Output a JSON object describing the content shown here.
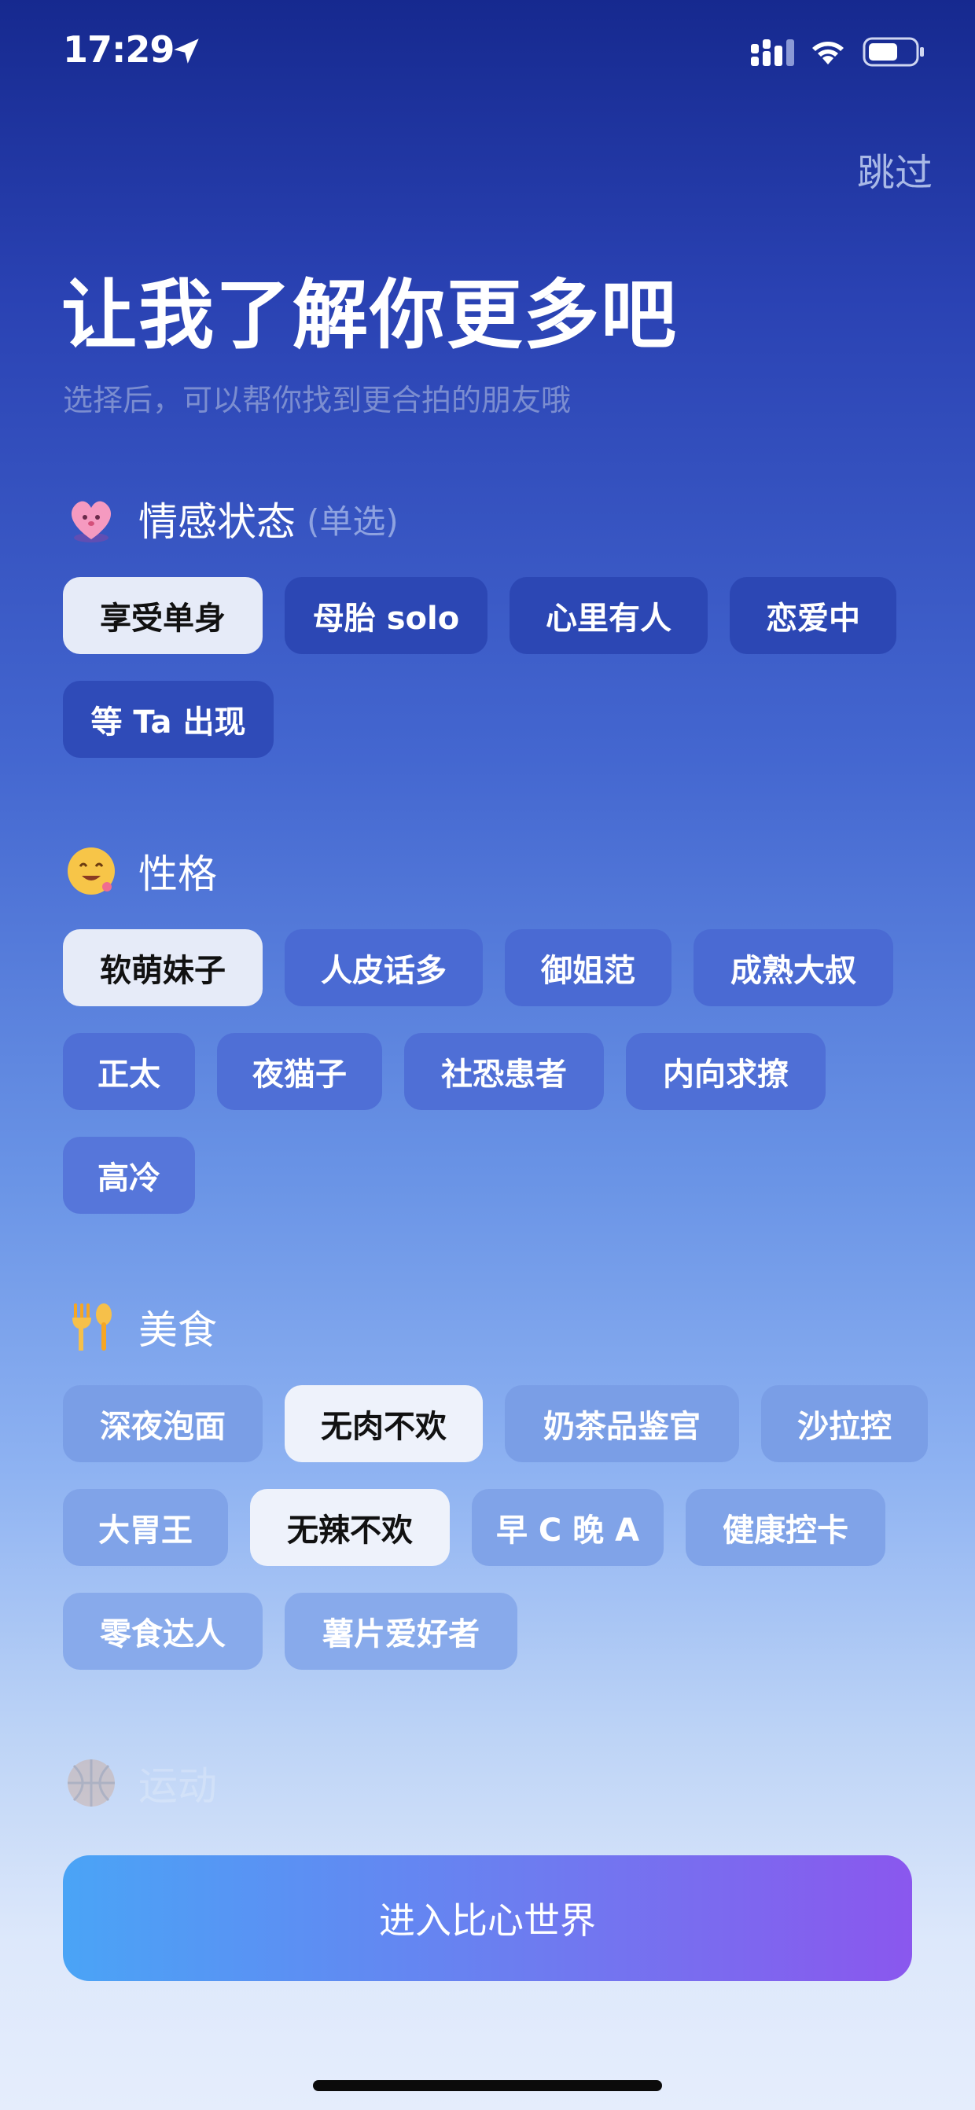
{
  "status_bar": {
    "time": "17:29",
    "icons": [
      "location-arrow-icon",
      "signal-icon",
      "wifi-icon",
      "battery-icon"
    ]
  },
  "header": {
    "skip_label": "跳过",
    "title": "让我了解你更多吧",
    "subtitle": "选择后，可以帮你找到更合拍的朋友哦"
  },
  "sections": {
    "emotion": {
      "title": "情感状态",
      "note": "(单选)",
      "icon": "heart-face-icon",
      "tags": [
        "享受单身",
        "母胎 solo",
        "心里有人",
        "恋爱中",
        "等 Ta 出现"
      ],
      "selected": [
        "享受单身"
      ]
    },
    "personality": {
      "title": "性格",
      "icon": "smiley-face-icon",
      "tags": [
        "软萌妹子",
        "人皮话多",
        "御姐范",
        "成熟大叔",
        "正太",
        "夜猫子",
        "社恐患者",
        "内向求撩",
        "高冷"
      ],
      "selected": [
        "软萌妹子"
      ]
    },
    "food": {
      "title": "美食",
      "icon": "fork-spoon-icon",
      "tags": [
        "深夜泡面",
        "无肉不欢",
        "奶茶品鉴官",
        "沙拉控",
        "大胃王",
        "无辣不欢",
        "早 C 晚 A",
        "健康控卡",
        "零食达人",
        "薯片爱好者"
      ],
      "selected": [
        "无肉不欢",
        "无辣不欢"
      ]
    },
    "sports": {
      "title": "运动",
      "icon": "basketball-icon"
    }
  },
  "enter_button": {
    "label": "进入比心世界"
  },
  "colors": {
    "tag_unselected_emotion": "#2c47b4",
    "tag_unselected_personality": "#4a6ad3",
    "tag_unselected_food": "#7a9ee6",
    "tag_selected": "#e6ebf8",
    "button_gradient_start": "#4aa4f6",
    "button_gradient_end": "#8a57ee"
  }
}
